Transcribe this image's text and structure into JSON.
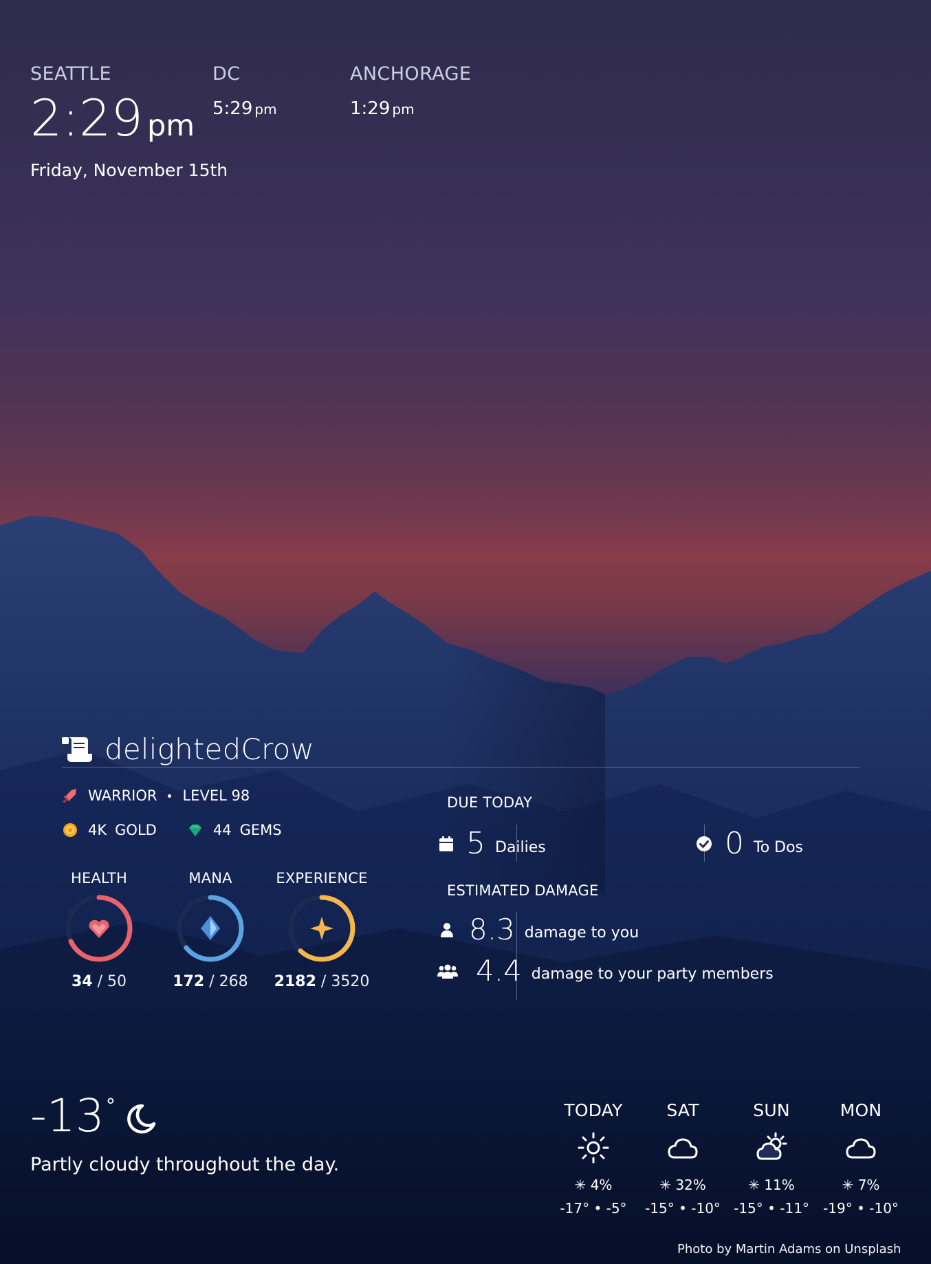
{
  "clocks": {
    "primary": {
      "city": "SEATTLE",
      "time": "2:29",
      "ampm": "pm",
      "date": "Friday, November 15th"
    },
    "secondary": [
      {
        "city": "DC",
        "time": "5:29",
        "ampm": "pm"
      },
      {
        "city": "ANCHORAGE",
        "time": "1:29",
        "ampm": "pm"
      }
    ]
  },
  "habitica": {
    "username": "delightedCrow",
    "class_name": "WARRIOR",
    "level_text": "LEVEL 98",
    "gold_value": "4K",
    "gold_label": "GOLD",
    "gems_value": "44",
    "gems_label": "GEMS",
    "stats": {
      "health": {
        "label": "HEALTH",
        "current": "34",
        "separator": "/",
        "max": "50",
        "fraction": 0.68,
        "color": "#e9636a"
      },
      "mana": {
        "label": "MANA",
        "current": "172",
        "separator": "/",
        "max": "268",
        "fraction": 0.642,
        "color": "#5aa4e4"
      },
      "experience": {
        "label": "EXPERIENCE",
        "current": "2182",
        "separator": "/",
        "max": "3520",
        "fraction": 0.62,
        "color": "#f7b64c"
      }
    },
    "due_today": {
      "label": "DUE TODAY",
      "dailies_count": "5",
      "dailies_label": "Dailies",
      "todos_count": "0",
      "todos_label": "To Dos"
    },
    "estimated_damage": {
      "label": "ESTIMATED DAMAGE",
      "you_value": "8.3",
      "you_label": "damage to you",
      "party_value": "4.4",
      "party_label": "damage to your party members"
    }
  },
  "weather": {
    "current_temp": "-13",
    "degree": "°",
    "summary": "Partly cloudy throughout the day.",
    "forecast": [
      {
        "day": "TODAY",
        "icon": "sun-icon",
        "precip": "4%",
        "low": "-17°",
        "high": "-5°"
      },
      {
        "day": "SAT",
        "icon": "cloud-icon",
        "precip": "32%",
        "low": "-15°",
        "high": "-10°"
      },
      {
        "day": "SUN",
        "icon": "partly-cloudy-icon",
        "precip": "11%",
        "low": "-15°",
        "high": "-11°"
      },
      {
        "day": "MON",
        "icon": "cloud-icon",
        "precip": "7%",
        "low": "-19°",
        "high": "-10°"
      }
    ]
  },
  "photo_credit": "Photo by Martin Adams on Unsplash"
}
